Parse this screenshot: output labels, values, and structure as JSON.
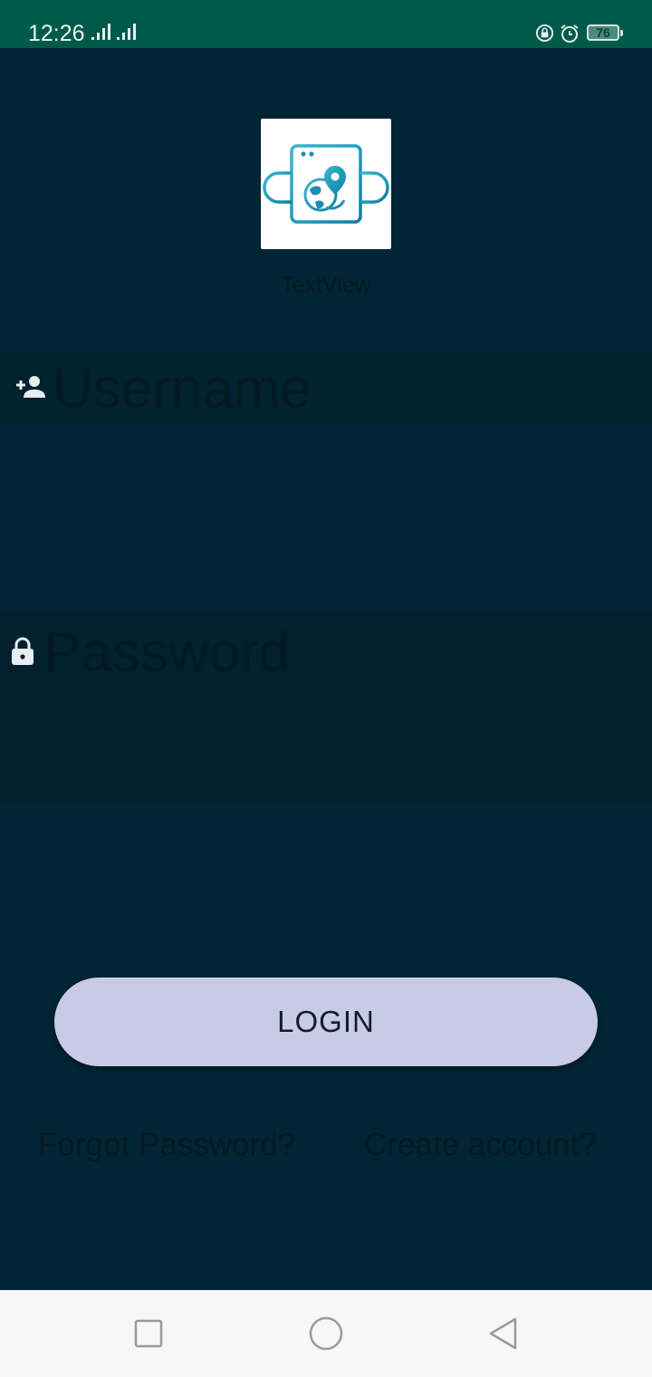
{
  "status_bar": {
    "time": "12:26",
    "battery_level": "76",
    "bg_color": "#005a4b",
    "icons": [
      "signal-icon",
      "signal-icon",
      "rotation-lock-icon",
      "alarm-icon",
      "battery-icon"
    ]
  },
  "app": {
    "logo_icon": "globe-location-pin-icon",
    "title": "TextView",
    "bg_color": "#022535"
  },
  "form": {
    "username_placeholder": "Username",
    "username_icon": "add-user-icon",
    "password_placeholder": "Password",
    "password_icon": "lock-icon",
    "login_label": "LOGIN",
    "login_color": "#c8cae6",
    "forgot_label": "Forgot Password?",
    "create_label": "Create account?"
  },
  "nav_bar": {
    "buttons": [
      "recents-square-icon",
      "home-circle-icon",
      "back-triangle-icon"
    ]
  }
}
